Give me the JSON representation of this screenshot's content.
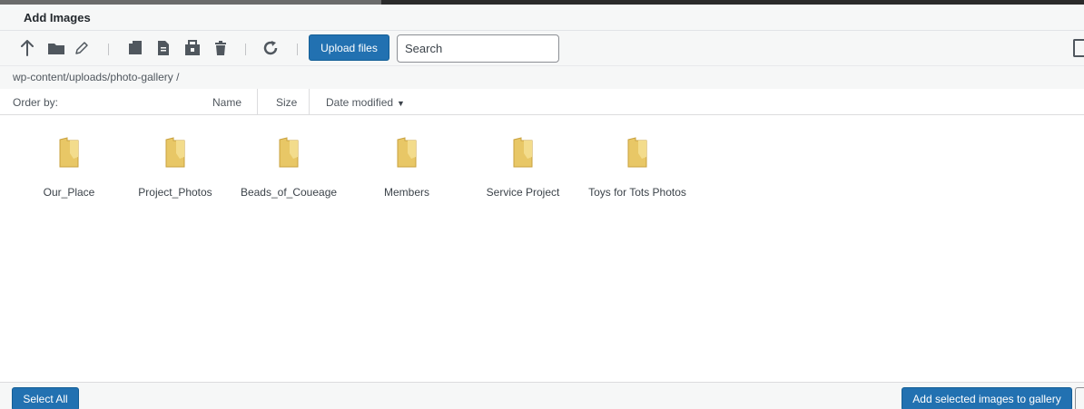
{
  "dialog": {
    "title": "Add Images"
  },
  "toolbar": {
    "icons": [
      "up-arrow-icon",
      "new-folder-icon",
      "rename-pencil-icon",
      "copy-icon",
      "paste-icon",
      "archive-icon",
      "delete-trash-icon",
      "refresh-icon"
    ],
    "upload_label": "Upload files",
    "search_placeholder": "Search"
  },
  "path": {
    "text": "wp-content/uploads/photo-gallery /"
  },
  "order": {
    "label": "Order by:",
    "name": "Name",
    "size": "Size",
    "date_modified": "Date modified",
    "sort_indicator": "▼"
  },
  "folders": [
    {
      "name": "Our_Place"
    },
    {
      "name": "Project_Photos"
    },
    {
      "name": "Beads_of_Coueage"
    },
    {
      "name": "Members"
    },
    {
      "name": "Service Project"
    },
    {
      "name": "Toys for Tots Photos"
    }
  ],
  "footer": {
    "select_all": "Select All",
    "add_selected": "Add selected images to gallery"
  },
  "colors": {
    "primary_button": "#2271b1",
    "folder_fill": "#e8c766",
    "icon_gray": "#50575e"
  }
}
